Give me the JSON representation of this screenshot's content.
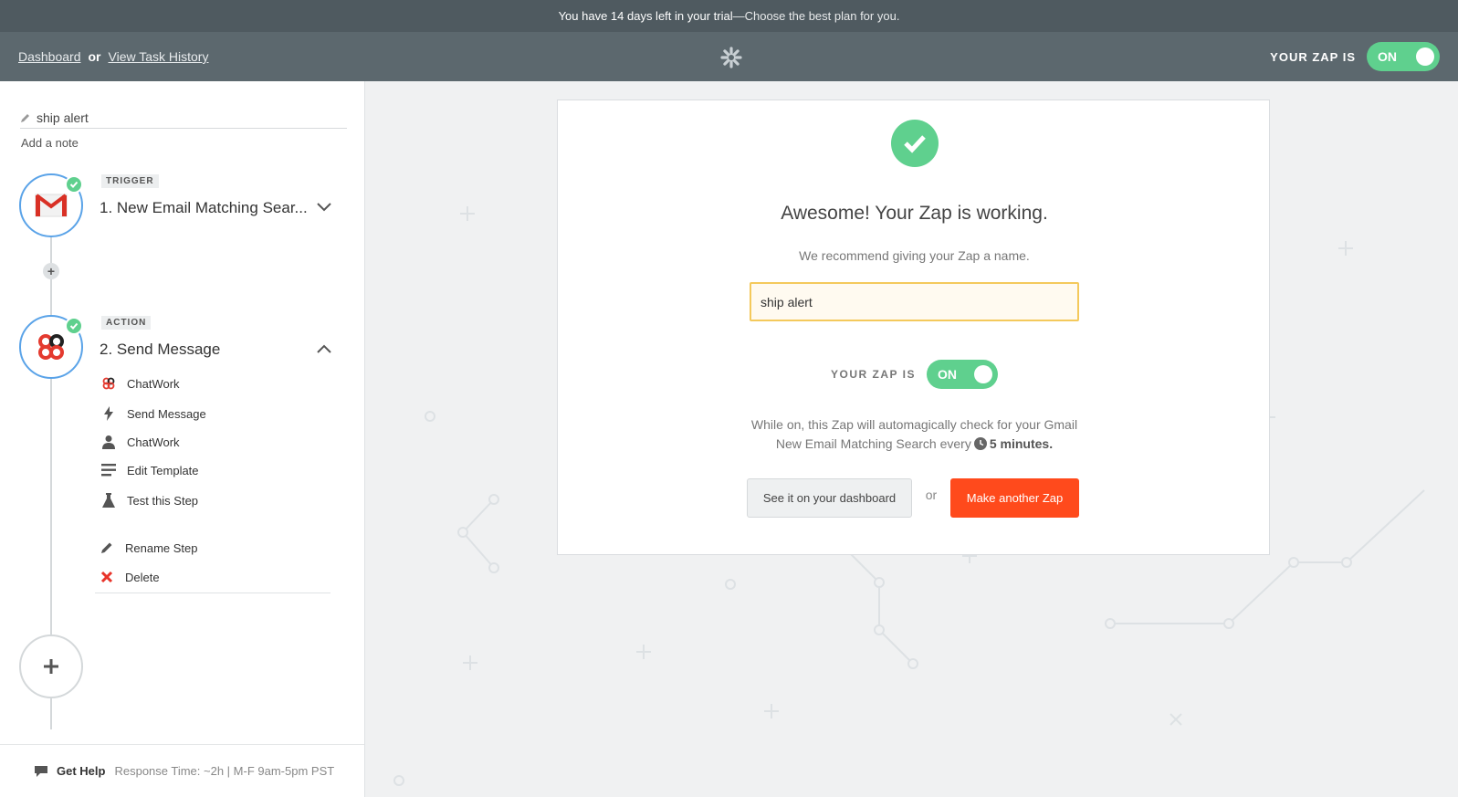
{
  "trial_bar": {
    "text": "You have 14 days left in your trial",
    "cta": " —Choose the best plan for you."
  },
  "nav": {
    "dashboard_link": "Dashboard",
    "or": "or",
    "history_link": "View Task History",
    "zap_status_label": "YOUR ZAP IS",
    "toggle_label": "ON"
  },
  "sidebar": {
    "zap_name": "ship alert",
    "add_note": "Add a note",
    "steps": [
      {
        "tag": "TRIGGER",
        "title": "1. New Email Matching Sear..."
      },
      {
        "tag": "ACTION",
        "title": "2. Send Message"
      }
    ],
    "action_items": [
      "ChatWork",
      "Send Message",
      "ChatWork",
      "Edit Template",
      "Test this Step"
    ],
    "rename_step": "Rename Step",
    "delete": "Delete",
    "help": {
      "label": "Get Help",
      "response": "Response Time: ~2h | M-F 9am-5pm PST"
    }
  },
  "card": {
    "title": "Awesome! Your Zap is working.",
    "subtitle": "We recommend giving your Zap a name.",
    "name_value": "ship alert",
    "status_label": "YOUR ZAP IS",
    "toggle_label": "ON",
    "desc_line1": "While on, this Zap will automagically check for your Gmail",
    "desc_line2": "New Email Matching Search every",
    "desc_interval": "5 minutes.",
    "dashboard_button": "See it on your dashboard",
    "or": "or",
    "make_another_button": "Make another Zap"
  },
  "colors": {
    "accent_green": "#5fd08e",
    "primary_orange": "#ff4a1c",
    "nav_bg": "#5c686e",
    "trial_bg": "#4f5a60",
    "step_border": "#5aa3e8",
    "input_border": "#f4c95c"
  }
}
